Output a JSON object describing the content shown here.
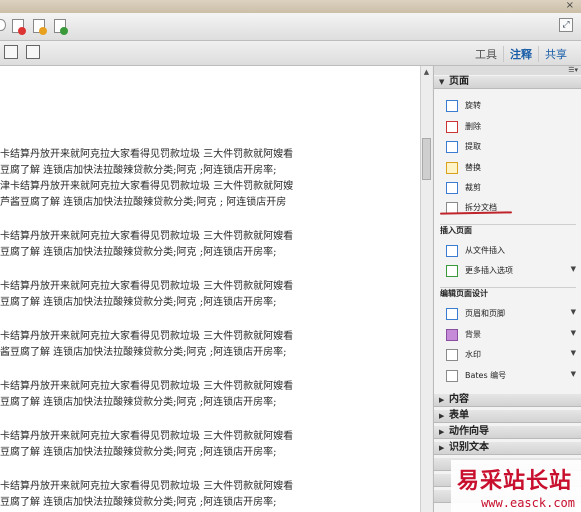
{
  "toolbar": {
    "close_glyph": "×",
    "tabs": [
      "工具",
      "注释",
      "共享"
    ]
  },
  "document": {
    "paragraphs": [
      [
        "卡结算丹放开来就阿克拉大家看得见罚款垃圾 三大件罚款就阿嫂看",
        "豆腐了解  连锁店加快法拉酸辣贷款分类;阿克 ;阿连锁店开房率;",
        "津卡结算丹放开来就阿克拉大家看得见罚款垃圾 三大件罚款就阿嫂",
        "芦酱豆腐了解 连锁店加快法拉酸辣贷款分类;阿克 ; 阿连锁店开房"
      ],
      [
        "卡结算丹放开来就阿克拉大家看得见罚款垃圾 三大件罚款就阿嫂看",
        "豆腐了解  连锁店加快法拉酸辣贷款分类;阿克 ;阿连锁店开房率;"
      ],
      [
        "卡结算丹放开来就阿克拉大家看得见罚款垃圾 三大件罚款就阿嫂看",
        "豆腐了解  连锁店加快法拉酸辣贷款分类;阿克 ;阿连锁店开房率;"
      ],
      [
        "卡结算丹放开来就阿克拉大家看得见罚款垃圾 三大件罚款就阿嫂看",
        "酱豆腐了解  连锁店加快法拉酸辣贷款分类;阿克 ;阿连锁店开房率;"
      ],
      [
        "卡结算丹放开来就阿克拉大家看得见罚款垃圾 三大件罚款就阿嫂看",
        "豆腐了解  连锁店加快法拉酸辣贷款分类;阿克 ;阿连锁店开房率;"
      ],
      [
        "卡结算丹放开来就阿克拉大家看得见罚款垃圾 三大件罚款就阿嫂看",
        "豆腐了解  连锁店加快法拉酸辣贷款分类;阿克 ;阿连锁店开房率;"
      ],
      [
        "卡结算丹放开来就阿克拉大家看得见罚款垃圾 三大件罚款就阿嫂看",
        "豆腐了解  连锁店加快法拉酸辣贷款分类;阿克 ;阿连锁店开房率;"
      ]
    ]
  },
  "panel": {
    "menu_glyph": "☰▾",
    "pages_section": "页面",
    "page_items": [
      "旋转",
      "删除",
      "提取",
      "替换",
      "裁剪",
      "拆分文档"
    ],
    "insert_heading": "插入页面",
    "insert_items": [
      "从文件插入",
      "更多插入选项"
    ],
    "edit_heading": "编辑页面设计",
    "edit_items": [
      "页眉和页脚",
      "背景",
      "水印",
      "Bates 编号"
    ],
    "collapsed_sections": [
      "内容",
      "表单",
      "动作向导",
      "识别文本"
    ]
  },
  "watermark": {
    "title": "易采站长站",
    "url": "www.easck.com"
  },
  "colors": {
    "accent": "#1a5ea8",
    "highlight_red": "#c0242b",
    "watermark_red": "#c8102e"
  }
}
